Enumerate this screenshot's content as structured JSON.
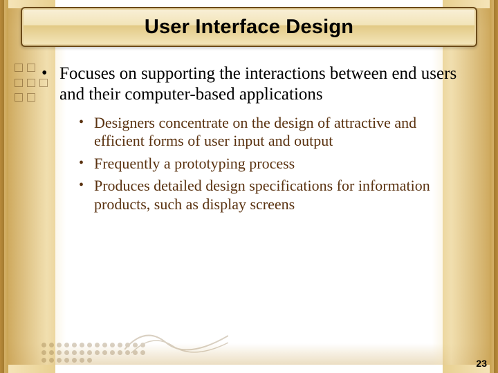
{
  "title": "User Interface Design",
  "bullets": {
    "main": "Focuses on supporting the interactions between end users and their computer-based applications",
    "sub": [
      "Designers concentrate on the design of attractive and efficient forms of user input and output",
      "Frequently a prototyping process",
      "Produces detailed design specifications for information products, such as display screens"
    ]
  },
  "page_number": "23"
}
